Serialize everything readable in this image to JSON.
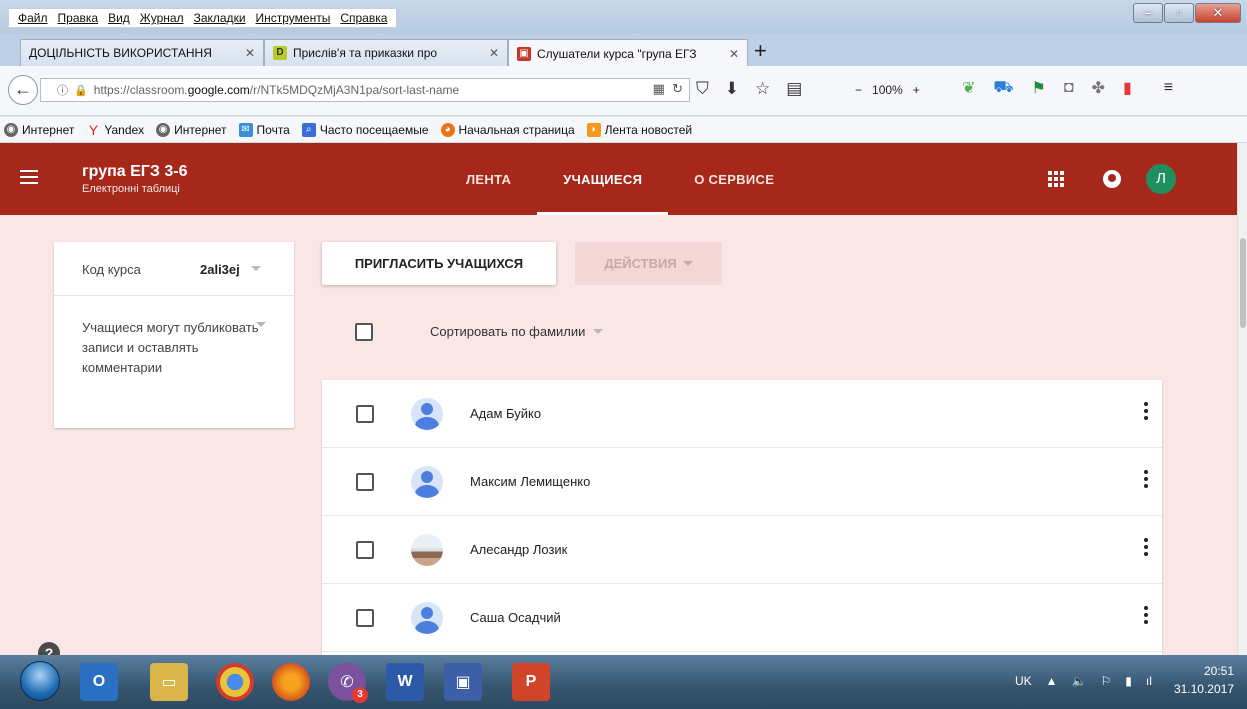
{
  "menubar": {
    "items": [
      "Файл",
      "Правка",
      "Вид",
      "Журнал",
      "Закладки",
      "Инструменты",
      "Справка"
    ]
  },
  "tabs": [
    {
      "label": "ДОЦІЛЬНІСТЬ ВИКОРИСТАННЯ",
      "active": false
    },
    {
      "label": "Прислів'я та приказки про",
      "favicon": "D",
      "active": false
    },
    {
      "label": "Слушатели курса \"група ЕГЗ",
      "active": true
    }
  ],
  "urlbar": {
    "prefix": "https://classroom.",
    "host": "google.com",
    "path": "/r/NTk5MDQzMjA3N1pa/sort-last-name",
    "zoom": "100%"
  },
  "bookmarks": [
    {
      "label": "Интернет",
      "icon": "globe-icon"
    },
    {
      "label": "Yandex",
      "icon": "yandex-icon"
    },
    {
      "label": "Интернет",
      "icon": "globe-icon"
    },
    {
      "label": "Почта",
      "icon": "mail-icon"
    },
    {
      "label": "Часто посещаемые",
      "icon": "search-icon"
    },
    {
      "label": "Начальная страница",
      "icon": "firefox-icon"
    },
    {
      "label": "Лента новостей",
      "icon": "rss-icon"
    }
  ],
  "header": {
    "course_title": "група ЕГЗ 3-6",
    "course_subtitle": "Електронні таблиці",
    "tabs": [
      {
        "label": "ЛЕНТА",
        "active": false
      },
      {
        "label": "УЧАЩИЕСЯ",
        "active": true
      },
      {
        "label": "О СЕРВИСЕ",
        "active": false
      }
    ],
    "avatar_letter": "Л",
    "accent_color": "#a5281b"
  },
  "sidebar": {
    "code_label": "Код курса",
    "code_value": "2ali3ej",
    "permission_text": "Учащиеся могут публиковать записи и оставлять комментарии"
  },
  "toolbar": {
    "invite_label": "ПРИГЛАСИТЬ УЧАЩИХСЯ",
    "actions_label": "ДЕЙСТВИЯ",
    "sort_label": "Сортировать по фамилии"
  },
  "students": [
    {
      "name": "Адам Буйко",
      "avatar": "default"
    },
    {
      "name": "Максим Лемищенко",
      "avatar": "default"
    },
    {
      "name": "Алесандр Лозик",
      "avatar": "photo"
    },
    {
      "name": "Саша Осадчий",
      "avatar": "default"
    }
  ],
  "taskbar": {
    "lang": "UK",
    "time": "20:51",
    "date": "31.10.2017",
    "viber_badge": "3"
  }
}
